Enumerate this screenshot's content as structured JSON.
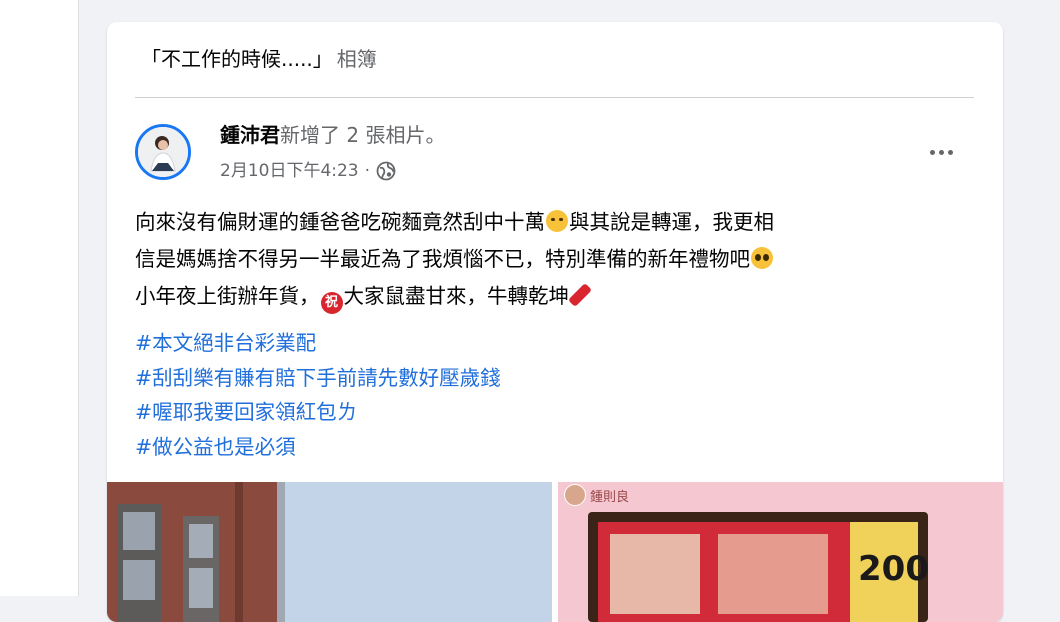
{
  "album": {
    "title": "「不工作的時候.....」",
    "suffix": "相簿"
  },
  "post": {
    "author": "鍾沛君",
    "action": "新增了 2 張相片。",
    "timestamp": "2月10日下午4:23",
    "separator": "·",
    "audience_icon": "globe-icon",
    "more_icon": "more-options-icon",
    "text_lines": [
      {
        "before": "向來沒有偏財運的鍾爸爸吃碗麵竟然刮中十萬",
        "after": "與其說是轉運，我更相"
      },
      {
        "before": "信是媽媽捨不得另一半最近為了我煩惱不已，特別準備的新年禮物吧",
        "after": ""
      },
      {
        "before": "小年夜上街辦年貨，",
        "after": "大家鼠盡甘來，牛轉乾坤"
      }
    ],
    "emoji_zhu": "祝",
    "hashtags": [
      "#本文絕非台彩業配",
      "#刮刮樂有賺有賠下手前請先數好壓歲錢",
      "#喔耶我要回家領紅包ㄌ",
      "#做公益也是必須"
    ],
    "photo_right_caption": "鍾則良",
    "ticket_amount": "200"
  },
  "colors": {
    "link": "#216fdb",
    "accent": "#1877f2",
    "secondary_text": "#65676b",
    "background": "#f0f2f5"
  }
}
